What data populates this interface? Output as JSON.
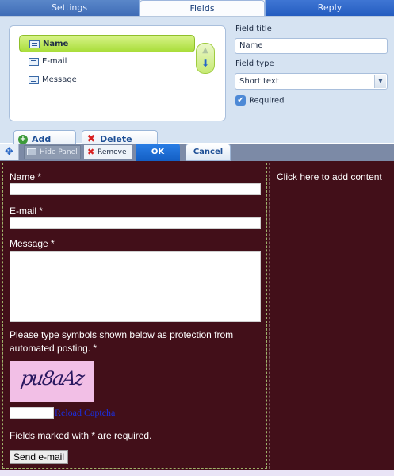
{
  "tabs": [
    {
      "label": "Settings"
    },
    {
      "label": "Fields"
    },
    {
      "label": "Reply"
    }
  ],
  "active_tab": "Fields",
  "fields_list": [
    {
      "label": "Name",
      "selected": true
    },
    {
      "label": "E-mail",
      "selected": false
    },
    {
      "label": "Message",
      "selected": false
    }
  ],
  "buttons": {
    "add_field": "Add Field",
    "delete_field": "Delete Field"
  },
  "properties": {
    "field_title_label": "Field title",
    "field_title_value": "Name",
    "field_type_label": "Field type",
    "field_type_value": "Short text",
    "required_label": "Required",
    "required_checked": true
  },
  "toolbar": {
    "hide_panel": "Hide Panel",
    "remove": "Remove",
    "ok": "OK",
    "cancel": "Cancel"
  },
  "form": {
    "name_label": "Name *",
    "email_label": "E-mail *",
    "message_label": "Message *",
    "captcha_notice": "Please type symbols shown below as protection from automated posting. *",
    "captcha_text": "pu8aAz",
    "reload_captcha": "Reload Captcha",
    "required_note": "Fields marked with * are required.",
    "send_button": "Send e-mail"
  },
  "sidebar": {
    "placeholder": "Click here to add content"
  },
  "colors": {
    "site_background": "#420f19",
    "panel_background": "#d6e3f2",
    "selected_field": "#a9dd3a",
    "ok_button": "#145fc4"
  }
}
